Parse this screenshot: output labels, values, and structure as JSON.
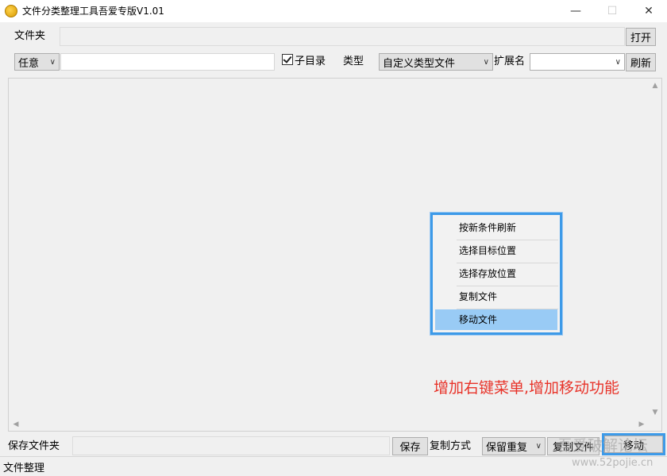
{
  "window": {
    "title": "文件分类整理工具吾爱专版V1.01",
    "controls": {
      "minimize": "—",
      "maximize": "☐",
      "close": "✕"
    }
  },
  "folder_row": {
    "label": "文件夹",
    "path_value": "",
    "open_button": "打开"
  },
  "filter_row": {
    "match_mode": "任意",
    "keyword_value": "",
    "subdir_label": "子目录",
    "subdir_checked": true,
    "type_label": "类型",
    "type_value": "自定义类型文件",
    "ext_label": "扩展名",
    "ext_value": "",
    "refresh_button": "刷新"
  },
  "context_menu": {
    "items": [
      "按新条件刷新",
      "选择目标位置",
      "选择存放位置",
      "复制文件",
      "移动文件"
    ],
    "selected": "移动文件"
  },
  "annotation": "增加右键菜单,增加移动功能",
  "save_row": {
    "label": "保存文件夹",
    "path_value": "",
    "save_button": "保存",
    "copy_mode_label": "复制方式",
    "copy_mode_value": "保留重复",
    "copy_button": "复制文件",
    "move_button": "移动"
  },
  "status": {
    "text": "文件整理"
  },
  "watermark": {
    "text": "吾爱破解论坛",
    "url": "www.52pojie.cn"
  },
  "colors": {
    "accent": "#3d9ae8",
    "menu_highlight": "#99cbf5",
    "annotation": "#e8342a"
  }
}
